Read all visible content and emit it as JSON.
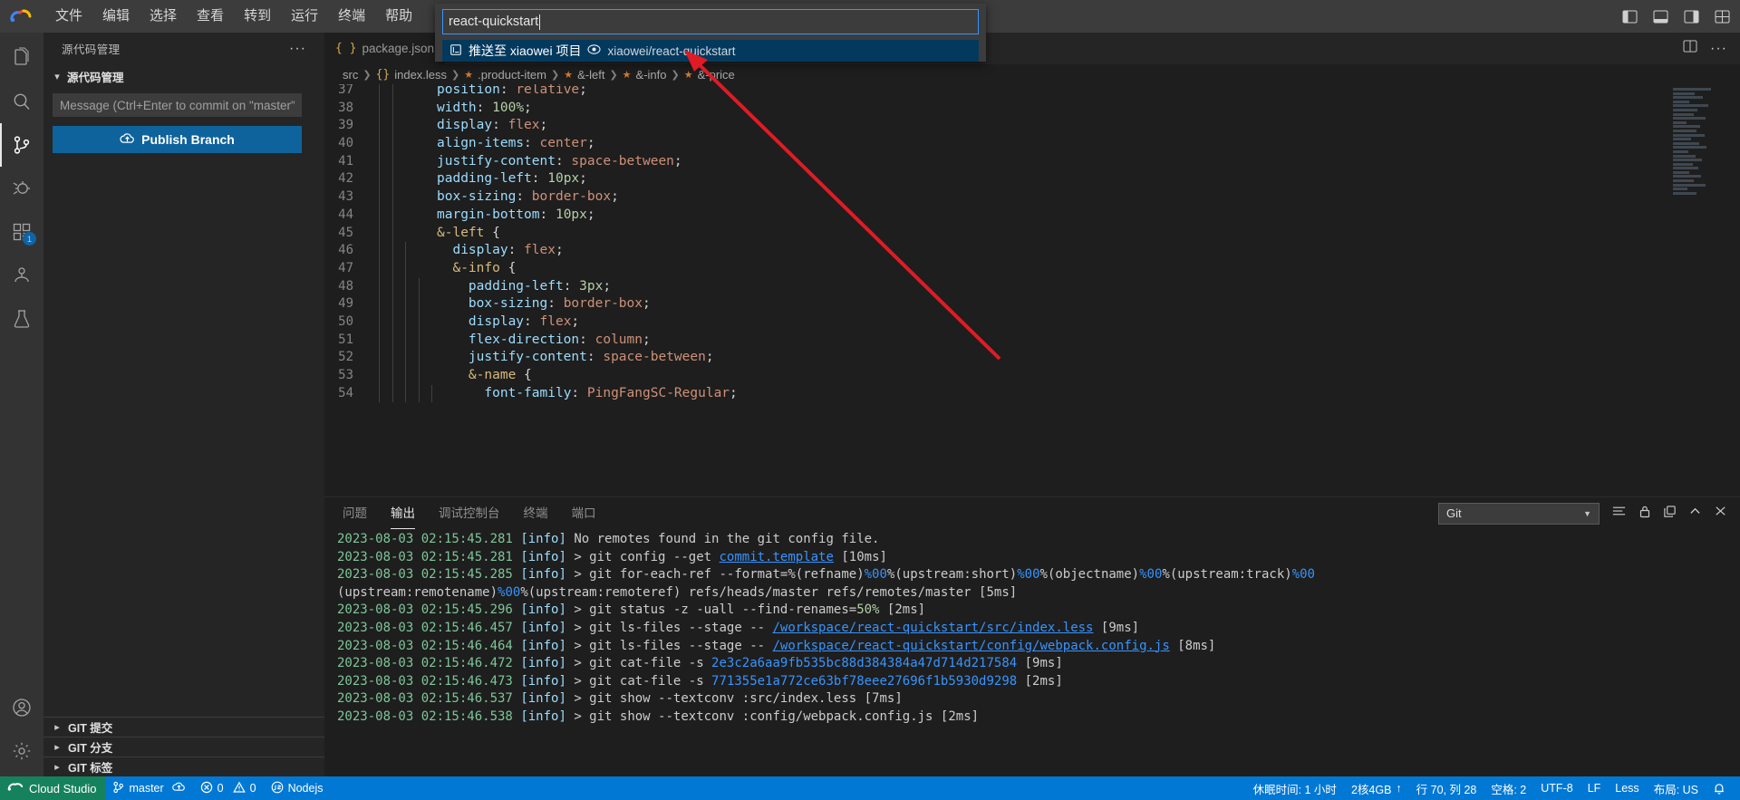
{
  "titlebar": {
    "logo_icon": "cloud-studio-logo",
    "menus": [
      "文件",
      "编辑",
      "选择",
      "查看",
      "转到",
      "运行",
      "终端",
      "帮助"
    ],
    "right_icons": [
      "toggle-primary-sidebar-icon",
      "toggle-panel-icon",
      "toggle-secondary-sidebar-icon",
      "customize-layout-icon"
    ]
  },
  "quick_input": {
    "value": "react-quickstart",
    "placeholder": "",
    "item": {
      "icon": "publish-repo-icon",
      "label": "推送至 xiaowei 项目",
      "remote_icon": "remote-source-icon",
      "description": "xiaowei/react-quickstart"
    }
  },
  "activitybar": {
    "items": [
      {
        "name": "explorer",
        "icon": "files-icon",
        "badge": ""
      },
      {
        "name": "search",
        "icon": "search-icon",
        "badge": ""
      },
      {
        "name": "source-control",
        "icon": "source-control-icon",
        "badge": "",
        "active": true
      },
      {
        "name": "run-and-debug",
        "icon": "debug-icon",
        "badge": ""
      },
      {
        "name": "extensions",
        "icon": "extensions-icon",
        "badge": "1"
      },
      {
        "name": "remote-explorer",
        "icon": "remote-explorer-icon",
        "badge": ""
      },
      {
        "name": "testing",
        "icon": "beaker-icon",
        "badge": ""
      }
    ],
    "bottom": [
      {
        "name": "accounts",
        "icon": "account-icon"
      },
      {
        "name": "manage",
        "icon": "gear-icon"
      }
    ]
  },
  "sidebar": {
    "title": "源代码管理",
    "more_actions": "···",
    "section_title": "源代码管理",
    "commit_placeholder": "Message (Ctrl+Enter to commit on \"master\")",
    "commit_value": "",
    "publish_label": "Publish Branch",
    "publish_icon": "cloud-upload-icon",
    "git_sections": [
      "GIT 提交",
      "GIT 分支",
      "GIT 标签"
    ]
  },
  "editor": {
    "tab": {
      "label": "package.json",
      "icon": "json-braces-icon"
    },
    "tab_actions": [
      "split-editor-icon",
      "more-actions-icon"
    ],
    "breadcrumb": [
      "src",
      "index.less",
      ".product-item",
      "&-left",
      "&-info",
      "&-price"
    ],
    "first_line_number": 37,
    "lines": [
      {
        "n": 37,
        "indent": 4,
        "text": "position: relative;",
        "prop": "position",
        "val": "relative"
      },
      {
        "n": 38,
        "indent": 4,
        "text": "width: 100%;",
        "prop": "width",
        "val": "100%"
      },
      {
        "n": 39,
        "indent": 4,
        "text": "display: flex;",
        "prop": "display",
        "val": "flex"
      },
      {
        "n": 40,
        "indent": 4,
        "text": "align-items: center;",
        "prop": "align-items",
        "val": "center"
      },
      {
        "n": 41,
        "indent": 4,
        "text": "justify-content: space-between;",
        "prop": "justify-content",
        "val": "space-between"
      },
      {
        "n": 42,
        "indent": 4,
        "text": "padding-left: 10px;",
        "prop": "padding-left",
        "val": "10px"
      },
      {
        "n": 43,
        "indent": 4,
        "text": "box-sizing: border-box;",
        "prop": "box-sizing",
        "val": "border-box"
      },
      {
        "n": 44,
        "indent": 4,
        "text": "margin-bottom: 10px;",
        "prop": "margin-bottom",
        "val": "10px"
      },
      {
        "n": 45,
        "indent": 4,
        "text": "&-left {",
        "prop": "&-left",
        "val": ""
      },
      {
        "n": 46,
        "indent": 6,
        "text": "display: flex;",
        "prop": "display",
        "val": "flex"
      },
      {
        "n": 47,
        "indent": 6,
        "text": "&-info {",
        "prop": "&-info",
        "val": ""
      },
      {
        "n": 48,
        "indent": 8,
        "text": "padding-left: 3px;",
        "prop": "padding-left",
        "val": "3px"
      },
      {
        "n": 49,
        "indent": 8,
        "text": "box-sizing: border-box;",
        "prop": "box-sizing",
        "val": "border-box"
      },
      {
        "n": 50,
        "indent": 8,
        "text": "display: flex;",
        "prop": "display",
        "val": "flex"
      },
      {
        "n": 51,
        "indent": 8,
        "text": "flex-direction: column;",
        "prop": "flex-direction",
        "val": "column"
      },
      {
        "n": 52,
        "indent": 8,
        "text": "justify-content: space-between;",
        "prop": "justify-content",
        "val": "space-between"
      },
      {
        "n": 53,
        "indent": 8,
        "text": "&-name {",
        "prop": "&-name",
        "val": ""
      },
      {
        "n": 54,
        "indent": 10,
        "text": "font-family: PingFangSC-Regular;",
        "prop": "font-family",
        "val": "PingFangSC-Regular"
      }
    ]
  },
  "panel": {
    "tabs": [
      "问题",
      "输出",
      "调试控制台",
      "终端",
      "端口"
    ],
    "active_tab": "输出",
    "channel": "Git",
    "actions": [
      "clear-output-icon",
      "lock-scroll-icon",
      "open-in-editor-icon",
      "maximize-panel-icon",
      "close-panel-icon"
    ],
    "logs": [
      {
        "ts": "2023-08-03 02:15:45.281",
        "lvl": "[info]",
        "msg": "No remotes found in the git config file."
      },
      {
        "ts": "2023-08-03 02:15:45.281",
        "lvl": "[info]",
        "msg": "> git config --get commit.template [10ms]"
      },
      {
        "ts": "2023-08-03 02:15:45.285",
        "lvl": "[info]",
        "msg": "> git for-each-ref --format=%(refname)%00%(upstream:short)%00%(objectname)%00%(upstream:track)%00"
      },
      {
        "ts": "",
        "lvl": "",
        "msg": "(upstream:remotename)%00%(upstream:remoteref) refs/heads/master refs/remotes/master [5ms]"
      },
      {
        "ts": "2023-08-03 02:15:45.296",
        "lvl": "[info]",
        "msg": "> git status -z -uall --find-renames=50% [2ms]"
      },
      {
        "ts": "2023-08-03 02:15:46.457",
        "lvl": "[info]",
        "msg": "> git ls-files --stage -- /workspace/react-quickstart/src/index.less [9ms]"
      },
      {
        "ts": "2023-08-03 02:15:46.464",
        "lvl": "[info]",
        "msg": "> git ls-files --stage -- /workspace/react-quickstart/config/webpack.config.js [8ms]"
      },
      {
        "ts": "2023-08-03 02:15:46.472",
        "lvl": "[info]",
        "msg": "> git cat-file -s 2e3c2a6aa9fb535bc88d384384a47d714d217584 [9ms]"
      },
      {
        "ts": "2023-08-03 02:15:46.473",
        "lvl": "[info]",
        "msg": "> git cat-file -s 771355e1a772ce63bf78eee27696f1b5930d9298 [2ms]"
      },
      {
        "ts": "2023-08-03 02:15:46.537",
        "lvl": "[info]",
        "msg": "> git show --textconv :src/index.less [7ms]"
      },
      {
        "ts": "2023-08-03 02:15:46.538",
        "lvl": "[info]",
        "msg": "> git show --textconv :config/webpack.config.js [2ms]"
      }
    ]
  },
  "statusbar": {
    "cloud_studio": "Cloud Studio",
    "branch": "master",
    "sync_icon": "cloud-sync-icon",
    "errors": "0",
    "warnings": "0",
    "runtime": "Nodejs",
    "sleep_time": "休眠时间: 1 小时",
    "spec": "2核4GB",
    "position": "行 70, 列 28",
    "indent": "空格: 2",
    "encoding": "UTF-8",
    "eol": "LF",
    "language": "Less",
    "layout": "布局: US",
    "bell_icon": "bell-icon"
  },
  "colors": {
    "statusbar_bg": "#0078d4",
    "cloud_green": "#16825d",
    "accent_blue": "#0e639c",
    "quickinput_selected": "#04395e",
    "annotation_red": "#e01b24"
  },
  "annotation": {
    "arrow": "red-arrow-pointing-to-quick-input-item"
  }
}
